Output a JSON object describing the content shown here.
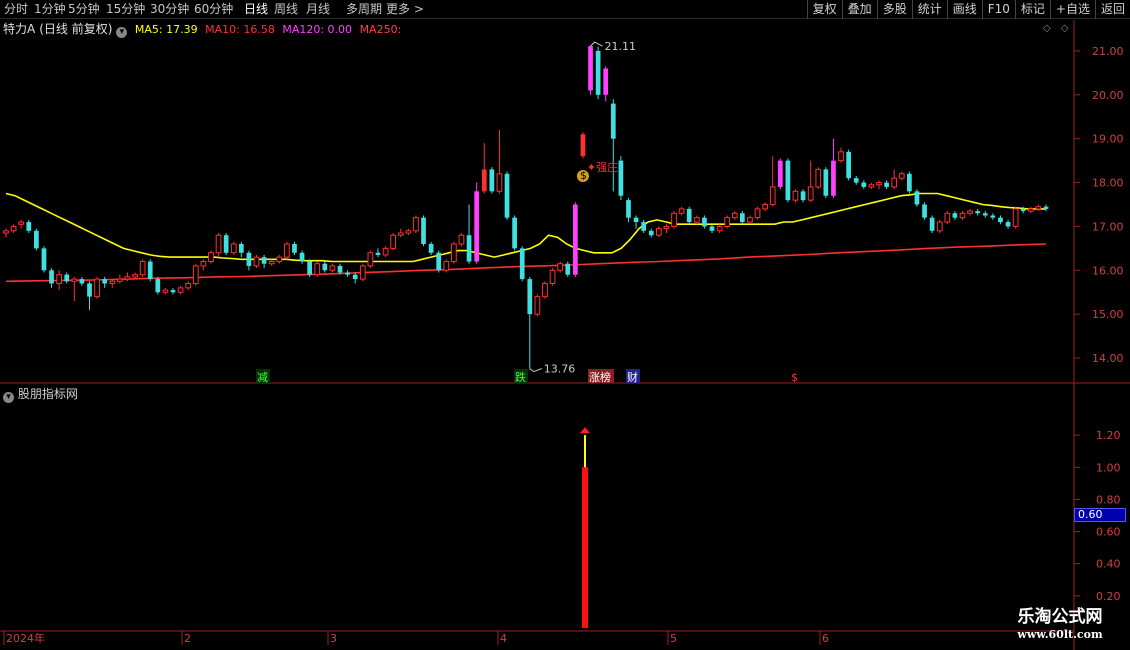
{
  "toolbar": {
    "periods": [
      "分时",
      "1分钟",
      "5分钟",
      "15分钟",
      "30分钟",
      "60分钟",
      "日线",
      "周线",
      "月线",
      "多周期",
      "更多"
    ],
    "active_period": "日线",
    "more_arrow": ">",
    "buttons": [
      "复权",
      "叠加",
      "多股",
      "统计",
      "画线",
      "F10",
      "标记",
      "+自选",
      "返回"
    ]
  },
  "main_legend": {
    "stock": "特力A",
    "mode": "(日线 前复权)",
    "menu_icon": "chevron-down-icon",
    "ma5_label": "MA5: 17.39",
    "ma10_label": "MA10: 16.58",
    "ma120_label": "MA120: 0.00",
    "ma250_label": "MA250:",
    "colors": {
      "ma5": "#ffff00",
      "ma10": "#ff3030",
      "ma120": "#ff40ff",
      "ma250": "#ff4040"
    }
  },
  "sub_legend": {
    "title": "股朋指标网",
    "menu_icon": "chevron-down-icon"
  },
  "corner_icons": [
    "diamond-icon",
    "diamond-outline-icon"
  ],
  "price_axis": [
    "21.00",
    "20.00",
    "19.00",
    "18.00",
    "17.00",
    "16.00",
    "15.00",
    "14.00"
  ],
  "indicator_axis": [
    "1.20",
    "1.00",
    "0.80",
    "0.60",
    "0.40",
    "0.20"
  ],
  "indicator_badge": "0.60",
  "date_axis": [
    "2024年",
    "2",
    "3",
    "4",
    "5",
    "6"
  ],
  "annotations": {
    "high_label": "21.11",
    "low_label": "13.76",
    "strong_label": "强庄",
    "event_tags": [
      "减",
      "跌",
      "涨榜",
      "财",
      "$"
    ]
  },
  "watermark": {
    "title": "乐淘公式网",
    "url": "www.60lt.com"
  },
  "chart_data": {
    "type": "candlestick",
    "price_range": [
      13.5,
      21.5
    ],
    "indicator_range": [
      0,
      1.4
    ],
    "candles": [
      [
        16.85,
        16.9,
        16.75,
        16.95
      ],
      [
        16.9,
        17.0,
        16.85,
        17.05
      ],
      [
        17.05,
        17.1,
        16.95,
        17.15
      ],
      [
        17.1,
        16.9,
        16.85,
        17.15
      ],
      [
        16.9,
        16.5,
        16.45,
        16.95
      ],
      [
        16.5,
        16.0,
        15.95,
        16.55
      ],
      [
        16.0,
        15.7,
        15.6,
        16.05
      ],
      [
        15.7,
        15.9,
        15.55,
        16.0
      ],
      [
        15.9,
        15.75,
        15.7,
        15.95
      ],
      [
        15.75,
        15.8,
        15.3,
        15.85
      ],
      [
        15.8,
        15.7,
        15.65,
        15.85
      ],
      [
        15.7,
        15.4,
        15.1,
        15.75
      ],
      [
        15.4,
        15.8,
        15.35,
        15.85
      ],
      [
        15.8,
        15.7,
        15.6,
        15.85
      ],
      [
        15.7,
        15.75,
        15.6,
        15.8
      ],
      [
        15.75,
        15.8,
        15.7,
        15.9
      ],
      [
        15.8,
        15.85,
        15.75,
        15.95
      ],
      [
        15.85,
        15.9,
        15.8,
        15.95
      ],
      [
        15.9,
        16.2,
        15.85,
        16.25
      ],
      [
        16.2,
        15.8,
        15.75,
        16.25
      ],
      [
        15.8,
        15.5,
        15.45,
        15.85
      ],
      [
        15.5,
        15.55,
        15.45,
        15.6
      ],
      [
        15.55,
        15.5,
        15.45,
        15.6
      ],
      [
        15.5,
        15.6,
        15.45,
        15.65
      ],
      [
        15.6,
        15.7,
        15.55,
        15.75
      ],
      [
        15.7,
        16.1,
        15.65,
        16.15
      ],
      [
        16.1,
        16.2,
        16.0,
        16.25
      ],
      [
        16.2,
        16.4,
        16.15,
        16.45
      ],
      [
        16.4,
        16.8,
        16.3,
        16.85
      ],
      [
        16.8,
        16.4,
        16.35,
        16.85
      ],
      [
        16.4,
        16.6,
        16.35,
        16.65
      ],
      [
        16.6,
        16.4,
        16.3,
        16.65
      ],
      [
        16.4,
        16.1,
        16.0,
        16.45
      ],
      [
        16.1,
        16.3,
        16.05,
        16.35
      ],
      [
        16.3,
        16.15,
        16.05,
        16.35
      ],
      [
        16.15,
        16.2,
        16.1,
        16.25
      ],
      [
        16.2,
        16.3,
        16.15,
        16.35
      ],
      [
        16.3,
        16.6,
        16.25,
        16.65
      ],
      [
        16.6,
        16.4,
        16.35,
        16.65
      ],
      [
        16.4,
        16.2,
        16.15,
        16.45
      ],
      [
        16.2,
        15.9,
        15.85,
        16.25
      ],
      [
        15.9,
        16.15,
        15.85,
        16.2
      ],
      [
        16.15,
        16.0,
        15.95,
        16.2
      ],
      [
        16.0,
        16.1,
        15.95,
        16.15
      ],
      [
        16.1,
        15.95,
        15.9,
        16.15
      ],
      [
        15.95,
        15.9,
        15.85,
        16.0
      ],
      [
        15.9,
        15.8,
        15.7,
        15.95
      ],
      [
        15.8,
        16.1,
        15.75,
        16.15
      ],
      [
        16.1,
        16.4,
        16.05,
        16.45
      ],
      [
        16.4,
        16.35,
        16.3,
        16.5
      ],
      [
        16.35,
        16.5,
        16.3,
        16.55
      ],
      [
        16.5,
        16.8,
        16.45,
        16.85
      ],
      [
        16.8,
        16.85,
        16.75,
        16.95
      ],
      [
        16.85,
        16.9,
        16.8,
        16.95
      ],
      [
        16.9,
        17.2,
        16.85,
        17.25
      ],
      [
        17.2,
        16.6,
        16.55,
        17.25
      ],
      [
        16.6,
        16.4,
        16.35,
        16.65
      ],
      [
        16.4,
        16.0,
        15.95,
        16.45
      ],
      [
        16.0,
        16.2,
        15.95,
        16.25
      ],
      [
        16.2,
        16.6,
        16.15,
        16.65
      ],
      [
        16.6,
        16.8,
        16.55,
        16.85
      ],
      [
        16.8,
        16.2,
        16.15,
        17.5
      ],
      [
        16.2,
        17.8,
        16.15,
        18.0
      ],
      [
        17.8,
        18.3,
        17.75,
        18.9
      ],
      [
        18.3,
        17.8,
        17.75,
        18.35
      ],
      [
        17.8,
        18.2,
        17.75,
        19.2
      ],
      [
        18.2,
        17.2,
        17.15,
        18.25
      ],
      [
        17.2,
        16.5,
        16.45,
        17.25
      ],
      [
        16.5,
        15.8,
        15.75,
        16.55
      ],
      [
        15.8,
        15.0,
        13.76,
        15.85
      ],
      [
        15.0,
        15.4,
        14.95,
        15.45
      ],
      [
        15.4,
        15.7,
        15.35,
        15.75
      ],
      [
        15.7,
        16.0,
        15.65,
        16.05
      ],
      [
        16.0,
        16.15,
        15.95,
        16.2
      ],
      [
        16.15,
        15.9,
        15.85,
        16.2
      ],
      [
        15.9,
        17.5,
        15.85,
        17.55
      ],
      [
        18.6,
        19.1,
        18.55,
        19.15
      ],
      [
        20.1,
        21.11,
        20.0,
        21.11
      ],
      [
        21.0,
        20.0,
        19.9,
        21.1
      ],
      [
        20.0,
        20.6,
        19.85,
        20.65
      ],
      [
        19.8,
        19.0,
        17.8,
        19.9
      ],
      [
        18.5,
        17.7,
        17.6,
        18.6
      ],
      [
        17.6,
        17.2,
        17.1,
        17.65
      ],
      [
        17.2,
        17.1,
        16.95,
        17.25
      ],
      [
        17.1,
        16.9,
        16.85,
        17.15
      ],
      [
        16.9,
        16.8,
        16.75,
        16.95
      ],
      [
        16.8,
        16.95,
        16.75,
        17.0
      ],
      [
        16.95,
        17.0,
        16.85,
        17.05
      ],
      [
        17.0,
        17.3,
        16.95,
        17.35
      ],
      [
        17.3,
        17.4,
        17.25,
        17.45
      ],
      [
        17.4,
        17.1,
        17.05,
        17.45
      ],
      [
        17.1,
        17.2,
        17.05,
        17.25
      ],
      [
        17.2,
        17.0,
        16.95,
        17.25
      ],
      [
        17.0,
        16.9,
        16.85,
        17.05
      ],
      [
        16.9,
        17.0,
        16.85,
        17.05
      ],
      [
        17.0,
        17.2,
        16.95,
        17.25
      ],
      [
        17.2,
        17.3,
        17.15,
        17.35
      ],
      [
        17.3,
        17.1,
        17.05,
        17.35
      ],
      [
        17.1,
        17.2,
        17.05,
        17.25
      ],
      [
        17.2,
        17.4,
        17.15,
        17.45
      ],
      [
        17.4,
        17.5,
        17.35,
        17.55
      ],
      [
        17.5,
        17.9,
        17.45,
        18.6
      ],
      [
        17.9,
        18.5,
        17.85,
        18.55
      ],
      [
        18.5,
        17.6,
        17.55,
        18.55
      ],
      [
        17.6,
        17.8,
        17.55,
        17.85
      ],
      [
        17.8,
        17.6,
        17.55,
        17.85
      ],
      [
        17.6,
        17.9,
        17.55,
        18.5
      ],
      [
        17.9,
        18.3,
        17.85,
        18.35
      ],
      [
        18.3,
        17.7,
        17.65,
        18.35
      ],
      [
        17.7,
        18.5,
        17.65,
        19.0
      ],
      [
        18.5,
        18.7,
        18.45,
        18.8
      ],
      [
        18.7,
        18.1,
        18.05,
        18.75
      ],
      [
        18.1,
        18.0,
        17.95,
        18.15
      ],
      [
        18.0,
        17.9,
        17.85,
        18.05
      ],
      [
        17.9,
        17.95,
        17.85,
        18.0
      ],
      [
        17.95,
        18.0,
        17.85,
        18.05
      ],
      [
        18.0,
        17.9,
        17.85,
        18.05
      ],
      [
        17.9,
        18.1,
        17.85,
        18.3
      ],
      [
        18.1,
        18.2,
        18.05,
        18.25
      ],
      [
        18.2,
        17.8,
        17.75,
        18.25
      ],
      [
        17.8,
        17.5,
        17.45,
        17.85
      ],
      [
        17.5,
        17.2,
        17.15,
        17.55
      ],
      [
        17.2,
        16.9,
        16.85,
        17.25
      ],
      [
        16.9,
        17.1,
        16.85,
        17.15
      ],
      [
        17.1,
        17.3,
        17.05,
        17.35
      ],
      [
        17.3,
        17.2,
        17.15,
        17.35
      ],
      [
        17.2,
        17.3,
        17.15,
        17.35
      ],
      [
        17.3,
        17.35,
        17.25,
        17.4
      ],
      [
        17.35,
        17.3,
        17.25,
        17.4
      ],
      [
        17.3,
        17.25,
        17.2,
        17.35
      ],
      [
        17.25,
        17.2,
        17.15,
        17.3
      ],
      [
        17.2,
        17.1,
        17.05,
        17.25
      ],
      [
        17.1,
        17.0,
        16.95,
        17.15
      ],
      [
        17.0,
        17.4,
        16.95,
        17.45
      ],
      [
        17.4,
        17.35,
        17.3,
        17.45
      ],
      [
        17.35,
        17.4,
        17.3,
        17.45
      ],
      [
        17.4,
        17.45,
        17.35,
        17.5
      ],
      [
        17.45,
        17.4,
        17.35,
        17.5
      ]
    ],
    "ma_yellow": [
      17.75,
      17.7,
      17.6,
      17.5,
      17.4,
      17.3,
      17.2,
      17.1,
      17.0,
      16.9,
      16.8,
      16.7,
      16.6,
      16.5,
      16.45,
      16.4,
      16.35,
      16.32,
      16.3,
      16.3,
      16.3,
      16.3,
      16.3,
      16.3,
      16.28,
      16.27,
      16.25,
      16.25,
      16.25,
      16.25,
      16.25,
      16.25,
      16.23,
      16.22,
      16.22,
      16.22,
      16.2,
      16.2,
      16.2,
      16.2,
      16.2,
      16.2,
      16.2,
      16.2,
      16.2,
      16.2,
      16.25,
      16.3,
      16.35,
      16.4,
      16.45,
      16.45,
      16.4,
      16.35,
      16.3,
      16.35,
      16.4,
      16.45,
      16.5,
      16.6,
      16.8,
      16.75,
      16.6,
      16.5,
      16.45,
      16.4,
      16.4,
      16.4,
      16.5,
      16.7,
      16.95,
      17.1,
      17.15,
      17.1,
      17.05,
      17.05,
      17.05,
      17.05,
      17.05,
      17.05,
      17.05,
      17.05,
      17.05,
      17.05,
      17.05,
      17.05,
      17.1,
      17.1,
      17.15,
      17.2,
      17.25,
      17.3,
      17.35,
      17.4,
      17.45,
      17.5,
      17.55,
      17.6,
      17.65,
      17.7,
      17.72,
      17.75,
      17.75,
      17.75,
      17.7,
      17.65,
      17.6,
      17.55,
      17.5,
      17.48,
      17.45,
      17.43,
      17.42,
      17.4,
      17.4,
      17.4
    ],
    "ma_red": [
      15.75,
      15.76,
      15.77,
      15.78,
      15.8,
      15.82,
      15.83,
      15.85,
      15.86,
      15.88,
      15.9,
      15.92,
      15.95,
      15.97,
      16.0,
      16.02,
      16.05,
      16.08,
      16.1,
      16.12,
      16.15,
      16.18,
      16.2,
      16.23,
      16.26,
      16.3,
      16.33,
      16.36,
      16.4,
      16.43,
      16.46,
      16.5,
      16.53,
      16.55,
      16.58,
      16.6
    ],
    "indicator_bar": {
      "red_value": 1.0,
      "yellow_value": 1.2
    }
  }
}
